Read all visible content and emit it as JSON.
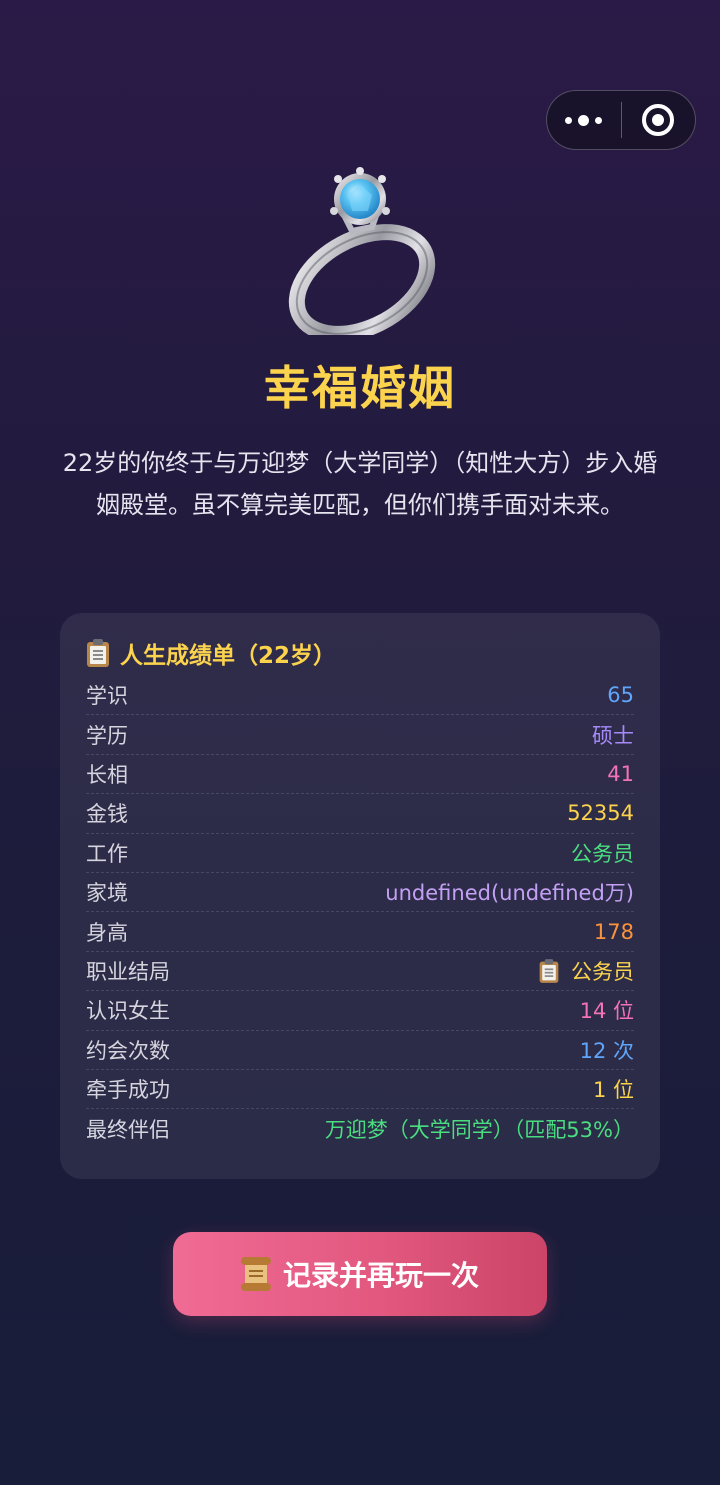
{
  "window": {
    "more_icon": "more-dots-icon",
    "close_icon": "target-close-icon"
  },
  "hero": {
    "icon": "ring-icon",
    "title": "幸福婚姻"
  },
  "description": "22岁的你终于与万迎梦（大学同学）（知性大方）步入婚姻殿堂。虽不算完美匹配，但你们携手面对未来。",
  "report": {
    "title": "人生成绩单（22岁）",
    "title_icon": "clipboard-icon",
    "rows": [
      {
        "label": "学识",
        "value": "65",
        "color": "#60a5fa"
      },
      {
        "label": "学历",
        "value": "硕士",
        "color": "#a78bfa"
      },
      {
        "label": "长相",
        "value": "41",
        "color": "#f472b6"
      },
      {
        "label": "金钱",
        "value": "52354",
        "color": "#fcd34d"
      },
      {
        "label": "工作",
        "value": "公务员",
        "color": "#4ade80"
      },
      {
        "label": "家境",
        "value": "undefined(undefined万)",
        "color": "#c4a0f5"
      },
      {
        "label": "身高",
        "value": "178",
        "color": "#fb923c"
      },
      {
        "label": "职业结局",
        "value": "公务员",
        "color": "#fcd34d",
        "icon": "clipboard-icon"
      },
      {
        "label": "认识女生",
        "value": "14 位",
        "color": "#f472b6"
      },
      {
        "label": "约会次数",
        "value": "12 次",
        "color": "#60a5fa"
      },
      {
        "label": "牵手成功",
        "value": "1 位",
        "color": "#fcd34d"
      },
      {
        "label": "最终伴侣",
        "value": "万迎梦（大学同学）（匹配53%）",
        "color": "#4ade80"
      }
    ]
  },
  "action": {
    "label": "记录并再玩一次",
    "icon": "scroll-icon"
  }
}
